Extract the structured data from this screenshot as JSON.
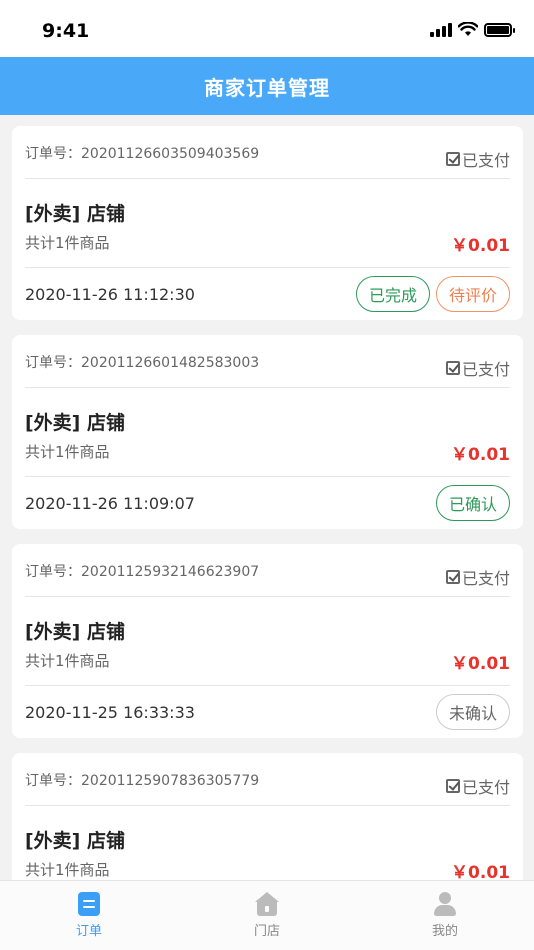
{
  "status_bar": {
    "time": "9:41"
  },
  "header": {
    "title": "商家订单管理"
  },
  "orders": [
    {
      "order_no": "订单号：20201126603509403569",
      "paid": "已支付",
      "shop": "[外卖] 店铺",
      "count": "共计1件商品",
      "price": "￥0.01",
      "time": "2020-11-26 11:12:30",
      "buttons": [
        {
          "label": "已完成",
          "style": "green"
        },
        {
          "label": "待评价",
          "style": "orange"
        }
      ]
    },
    {
      "order_no": "订单号：20201126601482583003",
      "paid": "已支付",
      "shop": "[外卖] 店铺",
      "count": "共计1件商品",
      "price": "￥0.01",
      "time": "2020-11-26 11:09:07",
      "buttons": [
        {
          "label": "已确认",
          "style": "green"
        }
      ]
    },
    {
      "order_no": "订单号：20201125932146623907",
      "paid": "已支付",
      "shop": "[外卖] 店铺",
      "count": "共计1件商品",
      "price": "￥0.01",
      "time": "2020-11-25 16:33:33",
      "buttons": [
        {
          "label": "未确认",
          "style": "gray"
        }
      ]
    },
    {
      "order_no": "订单号：20201125907836305779",
      "paid": "已支付",
      "shop": "[外卖] 店铺",
      "count": "共计1件商品",
      "price": "￥0.01",
      "time": "",
      "buttons": []
    }
  ],
  "tabbar": {
    "items": [
      {
        "label": "订单",
        "icon": "order-icon",
        "active": true
      },
      {
        "label": "门店",
        "icon": "store-icon",
        "active": false
      },
      {
        "label": "我的",
        "icon": "user-icon",
        "active": false
      }
    ]
  },
  "colors": {
    "header_bg": "#4aa8f9",
    "price": "#e8322c",
    "green": "#2e9a5a",
    "orange": "#f08050",
    "active_tab": "#3a9ff5"
  }
}
